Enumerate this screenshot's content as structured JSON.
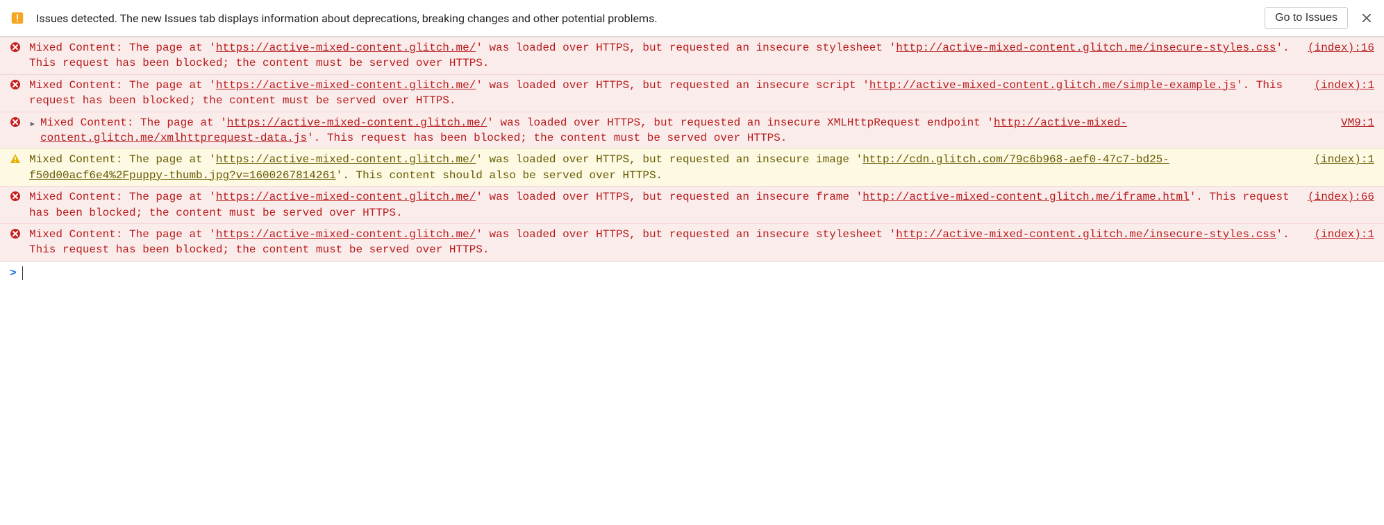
{
  "infobar": {
    "text": "Issues detected. The new Issues tab displays information about deprecations, breaking changes and other potential problems.",
    "button": "Go to Issues"
  },
  "messages": [
    {
      "level": "error",
      "disclosure": false,
      "prefix": "Mixed Content: The page at '",
      "page_url": "https://active-mixed-content.glitch.me/",
      "mid1": "' was loaded over HTTPS, but requested an insecure stylesheet '",
      "resource_url": "http://active-mixed-content.glitch.me/insecure-styles.css",
      "suffix": "'. This request has been blocked; the content must be served over HTTPS.",
      "source": "(index):16"
    },
    {
      "level": "error",
      "disclosure": false,
      "prefix": "Mixed Content: The page at '",
      "page_url": "https://active-mixed-content.glitch.me/",
      "mid1": "' was loaded over HTTPS, but requested an insecure script '",
      "resource_url": "http://active-mixed-content.glitch.me/simple-example.js",
      "suffix": "'. This request has been blocked; the content must be served over HTTPS.",
      "source": "(index):1"
    },
    {
      "level": "error",
      "disclosure": true,
      "prefix": "Mixed Content: The page at '",
      "page_url": "https://active-mixed-content.glitch.me/",
      "mid1": "' was loaded over HTTPS, but requested an insecure XMLHttpRequest endpoint '",
      "resource_url": "http://active-mixed-content.glitch.me/xmlhttprequest-data.js",
      "suffix": "'. This request has been blocked; the content must be served over HTTPS.",
      "source": "VM9:1"
    },
    {
      "level": "warning",
      "disclosure": false,
      "prefix": "Mixed Content: The page at '",
      "page_url": "https://active-mixed-content.glitch.me/",
      "mid1": "' was loaded over HTTPS, but requested an insecure image '",
      "resource_url": "http://cdn.glitch.com/79c6b968-aef0-47c7-bd25-f50d00acf6e4%2Fpuppy-thumb.jpg?v=1600267814261",
      "suffix": "'. This content should also be served over HTTPS.",
      "source": "(index):1"
    },
    {
      "level": "error",
      "disclosure": false,
      "prefix": "Mixed Content: The page at '",
      "page_url": "https://active-mixed-content.glitch.me/",
      "mid1": "' was loaded over HTTPS, but requested an insecure frame '",
      "resource_url": "http://active-mixed-content.glitch.me/iframe.html",
      "suffix": "'. This request has been blocked; the content must be served over HTTPS.",
      "source": "(index):66"
    },
    {
      "level": "error",
      "disclosure": false,
      "prefix": "Mixed Content: The page at '",
      "page_url": "https://active-mixed-content.glitch.me/",
      "mid1": "' was loaded over HTTPS, but requested an insecure stylesheet '",
      "resource_url": "http://active-mixed-content.glitch.me/insecure-styles.css",
      "suffix": "'. This request has been blocked; the content must be served over HTTPS.",
      "source": "(index):1"
    }
  ],
  "prompt": {
    "caret": ">"
  },
  "colors": {
    "error_bg": "#fbecec",
    "error_fg": "#b71c1c",
    "warn_bg": "#fdf9e3",
    "warn_fg": "#665c00",
    "prompt_blue": "#1a73e8"
  }
}
